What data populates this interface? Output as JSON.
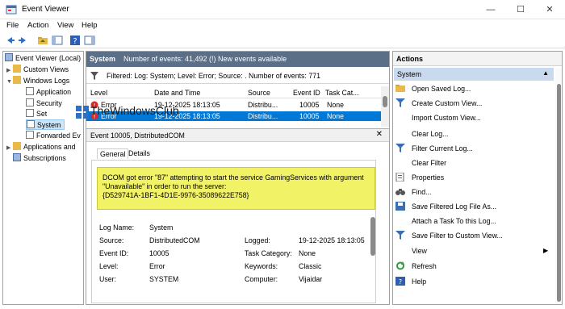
{
  "window": {
    "title": "Event Viewer"
  },
  "menu": [
    "File",
    "Action",
    "View",
    "Help"
  ],
  "tree": {
    "root": "Event Viewer (Local)",
    "custom_views": "Custom Views",
    "windows_logs": "Windows Logs",
    "application": "Application",
    "security": "Security",
    "setup": "Set",
    "system": "System",
    "forwarded": "Forwarded Ev",
    "apps_services": "Applications and",
    "subscriptions": "Subscriptions"
  },
  "center": {
    "log_name": "System",
    "summary": "Number of events: 41,492 (!) New events available",
    "filter_text": "Filtered: Log: System; Level: Error; Source: . Number of events: 771",
    "columns": [
      "Level",
      "Date and Time",
      "Source",
      "Event ID",
      "Task Cat..."
    ],
    "rows": [
      {
        "level": "Error",
        "datetime": "19-12-2025 18:13:05",
        "source": "Distribu...",
        "event_id": "10005",
        "task": "None"
      },
      {
        "level": "Error",
        "datetime": "19-12-2025 18:13:05",
        "source": "Distribu...",
        "event_id": "10005",
        "task": "None"
      }
    ],
    "detail_title": "Event 10005, DistributedCOM",
    "tabs": [
      "General",
      "Details"
    ],
    "description": [
      "DCOM got error \"87\" attempting to start the service GamingServices with argument",
      "\"Unavailable\" in order to run the server:",
      "{D529741A-1BF1-4D1E-9976-35089622E758}"
    ],
    "props": {
      "log_name_label": "Log Name:",
      "log_name": "System",
      "source_label": "Source:",
      "source": "DistributedCOM",
      "logged_label": "Logged:",
      "logged": "19-12-2025 18:13:05",
      "event_id_label": "Event ID:",
      "event_id": "10005",
      "task_category_label": "Task Category:",
      "task_category": "None",
      "level_label": "Level:",
      "level": "Error",
      "keywords_label": "Keywords:",
      "keywords": "Classic",
      "user_label": "User:",
      "user": "SYSTEM",
      "computer_label": "Computer:",
      "computer": "Vijaidar"
    }
  },
  "actions": {
    "title": "Actions",
    "section": "System",
    "items": [
      "Open Saved Log...",
      "Create Custom View...",
      "Import Custom View...",
      "Clear Log...",
      "Filter Current Log...",
      "Clear Filter",
      "Properties",
      "Find...",
      "Save Filtered Log File As...",
      "Attach a Task To this Log...",
      "Save Filter to Custom View...",
      "View",
      "Refresh",
      "Help"
    ]
  },
  "watermark": {
    "text": "TheWindowsClub"
  },
  "colors": {
    "header_bg": "#5b6f86",
    "selection": "#0078d7",
    "highlight": "#f2f266",
    "section_bg": "#c9d9ee"
  }
}
